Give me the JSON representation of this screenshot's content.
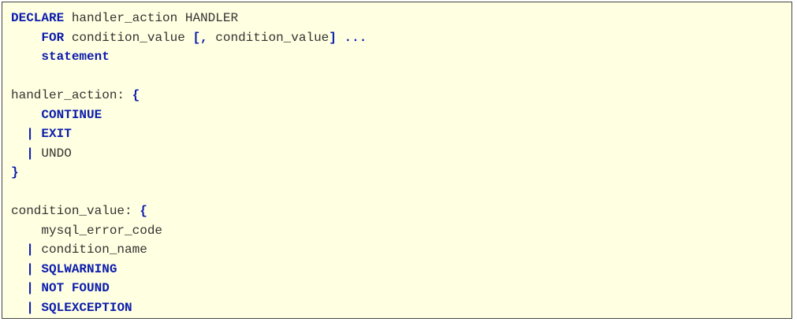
{
  "code_block": {
    "background": "#ffffe1",
    "keyword_color": "#0b1cad",
    "text_color": "#333333",
    "lines": [
      {
        "segments": [
          {
            "t": "DECLARE",
            "kw": true
          },
          {
            "t": " handler_action HANDLER",
            "kw": false
          }
        ]
      },
      {
        "segments": [
          {
            "t": "    ",
            "kw": false
          },
          {
            "t": "FOR",
            "kw": true
          },
          {
            "t": " condition_value ",
            "kw": false
          },
          {
            "t": "[,",
            "kw": true
          },
          {
            "t": " condition_value",
            "kw": false
          },
          {
            "t": "]",
            "kw": true
          },
          {
            "t": " ",
            "kw": false
          },
          {
            "t": "...",
            "kw": true
          }
        ]
      },
      {
        "segments": [
          {
            "t": "    ",
            "kw": false
          },
          {
            "t": "statement",
            "kw": true
          }
        ]
      },
      {
        "segments": []
      },
      {
        "segments": [
          {
            "t": "handler_action: ",
            "kw": false
          },
          {
            "t": "{",
            "kw": true
          }
        ]
      },
      {
        "segments": [
          {
            "t": "    ",
            "kw": false
          },
          {
            "t": "CONTINUE",
            "kw": true
          }
        ]
      },
      {
        "segments": [
          {
            "t": "  ",
            "kw": false
          },
          {
            "t": "|",
            "kw": true
          },
          {
            "t": " ",
            "kw": false
          },
          {
            "t": "EXIT",
            "kw": true
          }
        ]
      },
      {
        "segments": [
          {
            "t": "  ",
            "kw": false
          },
          {
            "t": "|",
            "kw": true
          },
          {
            "t": " UNDO",
            "kw": false
          }
        ]
      },
      {
        "segments": [
          {
            "t": "}",
            "kw": true
          }
        ]
      },
      {
        "segments": []
      },
      {
        "segments": [
          {
            "t": "condition_value: ",
            "kw": false
          },
          {
            "t": "{",
            "kw": true
          }
        ]
      },
      {
        "segments": [
          {
            "t": "    mysql_error_code",
            "kw": false
          }
        ]
      },
      {
        "segments": [
          {
            "t": "  ",
            "kw": false
          },
          {
            "t": "|",
            "kw": true
          },
          {
            "t": " condition_name",
            "kw": false
          }
        ]
      },
      {
        "segments": [
          {
            "t": "  ",
            "kw": false
          },
          {
            "t": "|",
            "kw": true
          },
          {
            "t": " ",
            "kw": false
          },
          {
            "t": "SQLWARNING",
            "kw": true
          }
        ]
      },
      {
        "segments": [
          {
            "t": "  ",
            "kw": false
          },
          {
            "t": "|",
            "kw": true
          },
          {
            "t": " ",
            "kw": false
          },
          {
            "t": "NOT FOUND",
            "kw": true
          }
        ]
      },
      {
        "segments": [
          {
            "t": "  ",
            "kw": false
          },
          {
            "t": "|",
            "kw": true
          },
          {
            "t": " ",
            "kw": false
          },
          {
            "t": "SQLEXCEPTION",
            "kw": true
          }
        ]
      }
    ]
  }
}
